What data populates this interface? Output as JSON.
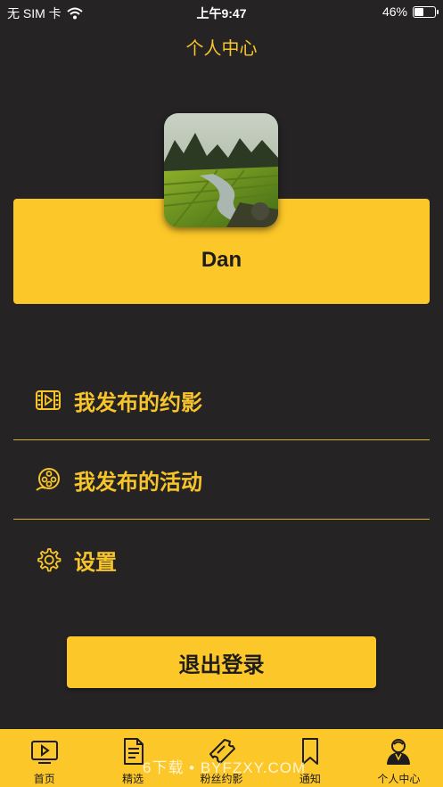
{
  "status_bar": {
    "carrier": "无 SIM 卡",
    "time": "上午9:47",
    "battery_percent": "46%",
    "battery_level": 0.46
  },
  "nav": {
    "title": "个人中心"
  },
  "profile": {
    "username": "Dan"
  },
  "menu": [
    {
      "label": "我发布的约影",
      "icon": "film-strip-icon"
    },
    {
      "label": "我发布的活动",
      "icon": "film-reel-icon"
    },
    {
      "label": "设置",
      "icon": "gear-icon"
    }
  ],
  "logout_label": "退出登录",
  "tabs": [
    {
      "label": "首页",
      "icon": "play-screen-icon"
    },
    {
      "label": "精选",
      "icon": "document-icon"
    },
    {
      "label": "粉丝约影",
      "icon": "ticket-icon"
    },
    {
      "label": "通知",
      "icon": "bookmark-icon"
    },
    {
      "label": "个人中心",
      "icon": "person-icon"
    }
  ],
  "watermark": "6下载 • BYFZXY.COM",
  "colors": {
    "accent": "#fcc728",
    "background": "#252324",
    "text_dark": "#1e1c1c"
  }
}
